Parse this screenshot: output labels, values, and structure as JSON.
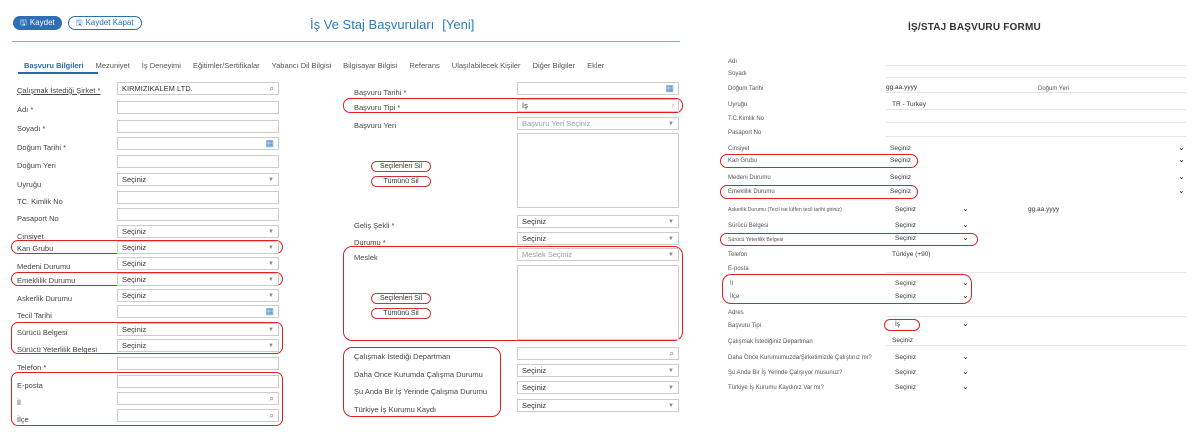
{
  "toolbar": {
    "save_label": "Kaydet",
    "save_close_label": "Kaydet Kapat"
  },
  "page_title": "İş Ve Staj Başvuruları",
  "page_badge": "[Yeni]",
  "tabs": [
    {
      "label": "Başvuru Bilgileri"
    },
    {
      "label": "Mezuniyet"
    },
    {
      "label": "İş Deneyimi"
    },
    {
      "label": "Eğitimler/Sertifikalar"
    },
    {
      "label": "Yabancı Dil Bilgisi"
    },
    {
      "label": "Bilgisayar Bilgisi"
    },
    {
      "label": "Referans"
    },
    {
      "label": "Ulaşılabilecek Kişiler"
    },
    {
      "label": "Diğer Bilgiler"
    },
    {
      "label": "Ekler"
    }
  ],
  "left": {
    "company_label": "Çalışmak İstediği Şirket *",
    "company_value": "KIRMIZIKALEM LTD.",
    "ad_label": "Adı *",
    "soyad_label": "Soyadı *",
    "dogum_label": "Doğum Tarihi *",
    "dogum_yeri_label": "Doğum Yeri",
    "uyruk_label": "Uyruğu",
    "uyruk_value": "Seçiniz",
    "tc_label": "TC. Kimlik No",
    "pasaport_label": "Pasaport No",
    "cinsiyet_label": "Cinsiyet",
    "cinsiyet_value": "Seçiniz",
    "kan_label": "Kan Grubu",
    "kan_value": "Seçiniz",
    "medeni_label": "Medeni Durumu",
    "medeni_value": "Seçiniz",
    "emeklilik_label": "Emeklilik Durumu",
    "emeklilik_value": "Seçiniz",
    "askerlik_label": "Askerlik Durumu",
    "askerlik_value": "Seçiniz",
    "tecil_label": "Tecil Tarihi",
    "surucu_label": "Sürücü Belgesi",
    "surucu_value": "Seçiniz",
    "yeterlilik_label": "Sürücü Yeterlilik Belgesi",
    "yeterlilik_value": "Seçiniz",
    "telefon_label": "Telefon *",
    "eposta_label": "E-posta",
    "il_label": "İl",
    "ilce_label": "İlçe"
  },
  "middle": {
    "basvuru_tarihi_label": "Başvuru Tarihi *",
    "basvuru_tipi_label": "Başvuru Tipi *",
    "basvuru_tipi_value": "İş",
    "basvuru_yeri_label": "Başvuru Yeri",
    "basvuru_yeri_placeholder": "Başvuru Yeri Seçiniz",
    "secilenleri_sil": "Seçilenleri Sil",
    "tumunu_sil": "Tümünü Sil",
    "gelis_label": "Geliş Şekli *",
    "gelis_value": "Seçiniz",
    "durumu_label": "Durumu *",
    "durumu_value": "Seçiniz",
    "meslek_label": "Meslek",
    "meslek_placeholder": "Meslek Seçiniz",
    "secilenleri_sil2": "Seçilenleri Sil",
    "tumunu_sil2": "Tümünü Sil",
    "departman_label": "Çalışmak İstediği Departman",
    "daha_once_label": "Daha Once Kurumda Çalışma Durumu",
    "daha_once_value": "Seçiniz",
    "su_anda_label": "Şu Anda Bir İş Yerinde Çalışma Durumu",
    "su_anda_value": "Seçiniz",
    "iskur_label": "Türkiye İş Kurumu Kaydı",
    "iskur_value": "Seçiniz"
  },
  "right": {
    "title": "İŞ/STAJ BAŞVURU FORMU",
    "adi": "Adı",
    "soyadi": "Soyadı",
    "dogum_tarihi": "Doğum Tarihi",
    "dogum_tarihi_value": "gg.aa.yyyy",
    "dogum_yeri": "Doğum Yeri",
    "uyrugu": "Uyruğu",
    "uyrugu_value": "TR - Turkey",
    "tc": "T.C.Kimlik No",
    "pasaport": "Pasaport No",
    "cinsiyet": "Cinsiyet",
    "cinsiyet_value": "Seçiniz",
    "kan": "Kan Grubu",
    "kan_value": "Seçiniz",
    "medeni": "Medeni Durumu",
    "medeni_value": "Seçiniz",
    "emeklilik": "Emeklilik Durumu",
    "emeklilik_value": "Seçiniz",
    "askerlik": "Askerlik Durumu (Tecil ise lütfen tecil tarihi giriniz)",
    "askerlik_value": "Seçiniz",
    "askerlik_date": "gg.aa.yyyy",
    "surucu": "Sürücü Belgesi",
    "surucu_value": "Seçiniz",
    "yeterlilik": "Sürücü Yeterlilik Belgesi",
    "yeterlilik_value": "Seçiniz",
    "telefon": "Telefon",
    "telefon_value": "Türkiye (+90)",
    "eposta": "E-posta",
    "il": "İl",
    "il_value": "Seçiniz",
    "ilce": "İlçe",
    "ilce_value": "Seçiniz",
    "adres": "Adres",
    "basvuru_tipi": "Başvuru Tipi",
    "basvuru_tipi_value": "İş",
    "departman": "Çalışmak İstediğiniz Departman",
    "departman_value": "Seçiniz",
    "daha_once": "Daha Önce Kurumumuzda/Şirketimizde Çalıştınız mı?",
    "daha_once_value": "Seçiniz",
    "su_anda": "Şu Anda Bir İş Yerinde Çalışıyor musunuz?",
    "su_anda_value": "Seçiniz",
    "iskur": "Türkiye İş Kurumu Kaydınız Var mı?",
    "iskur_value": "Seçiniz"
  },
  "colors": {
    "brand": "#2f6db4",
    "annotation": "#dd2222"
  }
}
